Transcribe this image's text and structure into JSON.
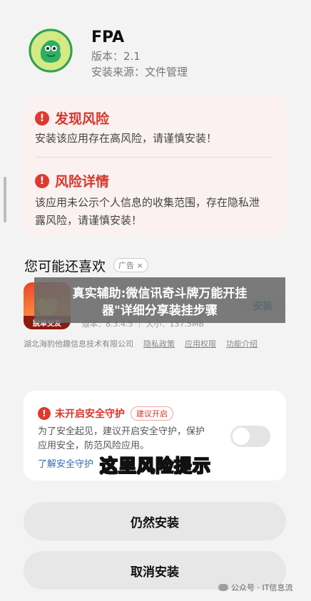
{
  "app": {
    "name": "FPA",
    "version": "版本：2.1",
    "source": "安装来源：文件管理"
  },
  "risks": [
    {
      "title": "发现风险",
      "desc": "安装该应用存在高风险，请谨慎安装！"
    },
    {
      "title": "风险详情",
      "desc_line1": "该应用未公示个人信息的收集范围，存在隐私泄",
      "desc_line2": "露风险，请谨慎安装！"
    }
  ],
  "recommend": {
    "title": "您可能还喜欢",
    "ad_tag": "广告",
    "ad_close": "×",
    "item": {
      "thumb_label": "脱单交友",
      "meta": "版本：8.3.4.5 ｜ 大小：137.5MB",
      "install": "安装"
    },
    "developer": "湖北海豹他趣信息技术有限公司",
    "links": [
      "隐私政策",
      "应用权限",
      "功能介绍"
    ]
  },
  "overlay": {
    "line1": "真实辅助:微信讯奇斗牌万能开挂",
    "line2": "器\"详细分享装挂步骤"
  },
  "security": {
    "title": "未开启安全守护",
    "tag": "建议开启",
    "desc_line1": "为了安全起见，建议开启安全守护，保护",
    "desc_line2": "应用安全，防范风险应用。",
    "link": "了解安全守护",
    "toggle_on": false
  },
  "caption": "这里风险提示",
  "buttons": {
    "continue": "仍然安装",
    "cancel": "取消安装"
  },
  "watermark": "公众号 · IT信息流",
  "colors": {
    "risk_red": "#d8362a",
    "risk_bg": "#fbf1f1",
    "link_blue": "#2f6bb5",
    "install_text": "#2b6f86"
  }
}
